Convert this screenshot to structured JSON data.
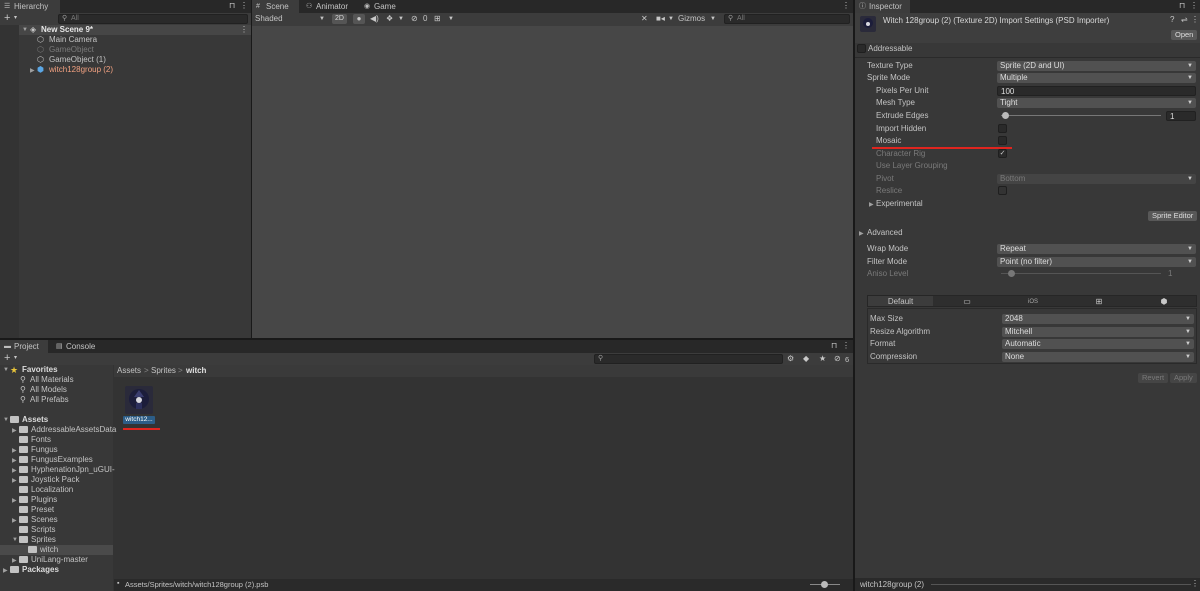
{
  "hierarchy": {
    "tab": "Hierarchy",
    "search_placeholder": "All",
    "scene": "New Scene 9*",
    "items": [
      "Main Camera",
      "GameObject",
      "GameObject (1)",
      "witch128group (2)"
    ]
  },
  "scene_view": {
    "tabs": [
      "Scene",
      "Animator",
      "Game"
    ],
    "shading": "Shaded",
    "mode_2d": "2D",
    "hidden_count": "0",
    "gizmos": "Gizmos",
    "search_placeholder": "All"
  },
  "project": {
    "tabs": [
      "Project",
      "Console"
    ],
    "favorites_label": "Favorites",
    "favorites": [
      "All Materials",
      "All Models",
      "All Prefabs"
    ],
    "assets_label": "Assets",
    "folders": [
      "AddressableAssetsData",
      "Fonts",
      "Fungus",
      "FungusExamples",
      "HyphenationJpn_uGUI-",
      "Joystick Pack",
      "Localization",
      "Plugins",
      "Preset",
      "Scenes",
      "Scripts",
      "Sprites"
    ],
    "subfolder": "witch",
    "other_roots": [
      "UniLang-master",
      "Packages"
    ],
    "breadcrumb": [
      "Assets",
      "Sprites",
      "witch"
    ],
    "asset_name": "witch12...",
    "path": "Assets/Sprites/witch/witch128group (2).psb",
    "visibility_count": "6"
  },
  "inspector": {
    "tab": "Inspector",
    "title": "Witch 128group (2) (Texture 2D) Import Settings (PSD Importer)",
    "open_button": "Open",
    "addressable": "Addressable",
    "texture_type_label": "Texture Type",
    "texture_type_value": "Sprite (2D and UI)",
    "sprite_mode_label": "Sprite Mode",
    "sprite_mode_value": "Multiple",
    "ppu_label": "Pixels Per Unit",
    "ppu_value": "100",
    "mesh_type_label": "Mesh Type",
    "mesh_type_value": "Tight",
    "extrude_label": "Extrude Edges",
    "extrude_value": "1",
    "import_hidden_label": "Import Hidden",
    "mosaic_label": "Mosaic",
    "character_rig_label": "Character Rig",
    "use_layer_grouping_label": "Use Layer Grouping",
    "pivot_label": "Pivot",
    "pivot_value": "Bottom",
    "reslice_label": "Reslice",
    "experimental_label": "Experimental",
    "sprite_editor_button": "Sprite Editor",
    "advanced_label": "Advanced",
    "wrap_mode_label": "Wrap Mode",
    "wrap_mode_value": "Repeat",
    "filter_mode_label": "Filter Mode",
    "filter_mode_value": "Point (no filter)",
    "aniso_label": "Aniso Level",
    "aniso_value": "1",
    "platform_tabs": [
      "Default",
      "monitor-icon",
      "iOS",
      "windows-icon",
      "android-icon"
    ],
    "max_size_label": "Max Size",
    "max_size_value": "2048",
    "resize_label": "Resize Algorithm",
    "resize_value": "Mitchell",
    "format_label": "Format",
    "format_value": "Automatic",
    "compression_label": "Compression",
    "compression_value": "None",
    "revert_button": "Revert",
    "apply_button": "Apply",
    "footer": "witch128group (2)"
  },
  "colors": {
    "highlight_red": "#e0251f",
    "selection_blue": "#2c5d87",
    "prefab_text": "#f0a080"
  }
}
